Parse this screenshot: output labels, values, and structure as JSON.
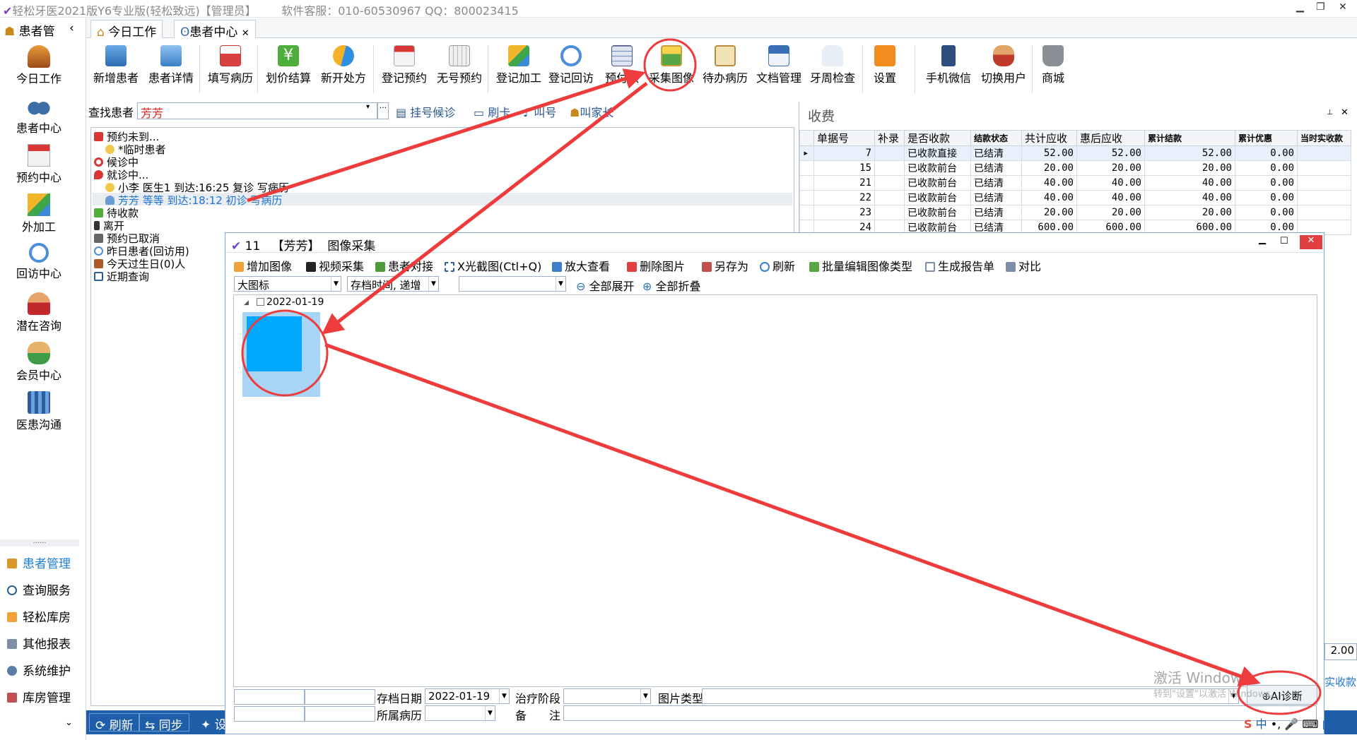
{
  "window": {
    "title": "轻松牙医2021版Y6专业版(轻松致远)【管理员】",
    "support": "软件客服：010-60530967  QQ：800023415"
  },
  "leftbar": {
    "header": "患者管",
    "big": [
      "今日工作",
      "患者中心",
      "预约中心",
      "外加工",
      "回访中心",
      "潜在咨询",
      "会员中心",
      "医患沟通"
    ],
    "dots": "......",
    "small": [
      "患者管理",
      "查询服务",
      "轻松库房",
      "其他报表",
      "系统维护",
      "库房管理"
    ],
    "active": "患者管理",
    "active_color": "#1e7fd8"
  },
  "tabs": [
    {
      "label": "今日工作"
    },
    {
      "label": "患者中心"
    }
  ],
  "toolbar": {
    "groups": [
      [
        "新增患者",
        "患者详情"
      ],
      [
        "填写病历"
      ],
      [
        "划价结算",
        "新开处方"
      ],
      [
        "登记预约",
        "无号预约"
      ],
      [
        "登记加工",
        "登记回访",
        "预付款",
        "采集图像",
        "待办病历",
        "文档管理",
        "牙周检查"
      ],
      [
        "设置"
      ],
      [
        "手机微信",
        "切换用户"
      ],
      [
        "商城"
      ]
    ]
  },
  "search": {
    "label": "查找患者",
    "value": "芳芳",
    "links": [
      "挂号候诊",
      "刷卡",
      "叫号",
      "叫家长"
    ]
  },
  "patients": {
    "items": [
      {
        "label": "预约未到...",
        "level": 0
      },
      {
        "label": "*临时患者",
        "level": 1
      },
      {
        "label": "候诊中",
        "level": 0
      },
      {
        "label": "就诊中...",
        "level": 0
      },
      {
        "label": "小李   医生1 到达:16:25 复诊 写病历",
        "level": 1
      },
      {
        "label": "芳芳   等等 到达:18:12 初诊 写病历",
        "level": 1,
        "selected": true
      },
      {
        "label": "待收款",
        "level": 0
      },
      {
        "label": "离开",
        "level": 0
      },
      {
        "label": "预约已取消",
        "level": 0
      },
      {
        "label": "昨日患者(回访用)",
        "level": 0
      },
      {
        "label": "今天过生日(0)人",
        "level": 0
      },
      {
        "label": "近期查询",
        "level": 0
      }
    ]
  },
  "bottom": {
    "buttons": [
      "刷新",
      "同步",
      "设"
    ]
  },
  "fee": {
    "title": "收费",
    "columns": [
      "单据号",
      "补录",
      "是否收款",
      "结款状态",
      "共计应收",
      "惠后应收",
      "累计结款",
      "累计优惠",
      "当时实收款"
    ],
    "rows": [
      [
        "7",
        "",
        "已收款直接",
        "已结清",
        "52.00",
        "52.00",
        "52.00",
        "0.00",
        ""
      ],
      [
        "15",
        "",
        "已收款前台",
        "已结清",
        "20.00",
        "20.00",
        "20.00",
        "0.00",
        ""
      ],
      [
        "21",
        "",
        "已收款前台",
        "已结清",
        "40.00",
        "40.00",
        "40.00",
        "0.00",
        ""
      ],
      [
        "22",
        "",
        "已收款前台",
        "已结清",
        "40.00",
        "40.00",
        "40.00",
        "0.00",
        ""
      ],
      [
        "23",
        "",
        "已收款前台",
        "已结清",
        "20.00",
        "20.00",
        "20.00",
        "0.00",
        ""
      ],
      [
        "24",
        "",
        "已收款前台",
        "已结清",
        "600.00",
        "600.00",
        "600.00",
        "0.00",
        ""
      ]
    ],
    "partial_value": "2.00",
    "partial_link": "实收款"
  },
  "dialog": {
    "title_num": "11",
    "title_patient": "【芳芳】",
    "title_text": "图像采集",
    "tools": [
      "增加图像",
      "视频采集",
      "患者对接",
      "X光截图(Ctl+Q)",
      "放大查看",
      "删除图片",
      "另存为",
      "刷新",
      "批量编辑图像类型",
      "生成报告单",
      "对比"
    ],
    "view_mode": "大图标",
    "sort": "存档时间, 递增",
    "filter": "",
    "expand_all": "全部展开",
    "collapse_all": "全部折叠",
    "group_date": "2022-01-19",
    "thumb_color": "#00a8ff",
    "form": {
      "archive_date_label": "存档日期",
      "archive_date": "2022-01-19",
      "stage_label": "治疗阶段",
      "stage": "",
      "type_label": "图片类型",
      "type": "",
      "record_label": "所属病历",
      "record": "",
      "note_label": "备　　注",
      "note": ""
    },
    "ai_button": "AI诊断"
  },
  "watermark": {
    "line1": "激活 Windows",
    "line2": "转到\"设置\"以激活 Windows。"
  },
  "taskbar": {
    "ime": "中"
  },
  "annotation_color": "#ee3b3b"
}
